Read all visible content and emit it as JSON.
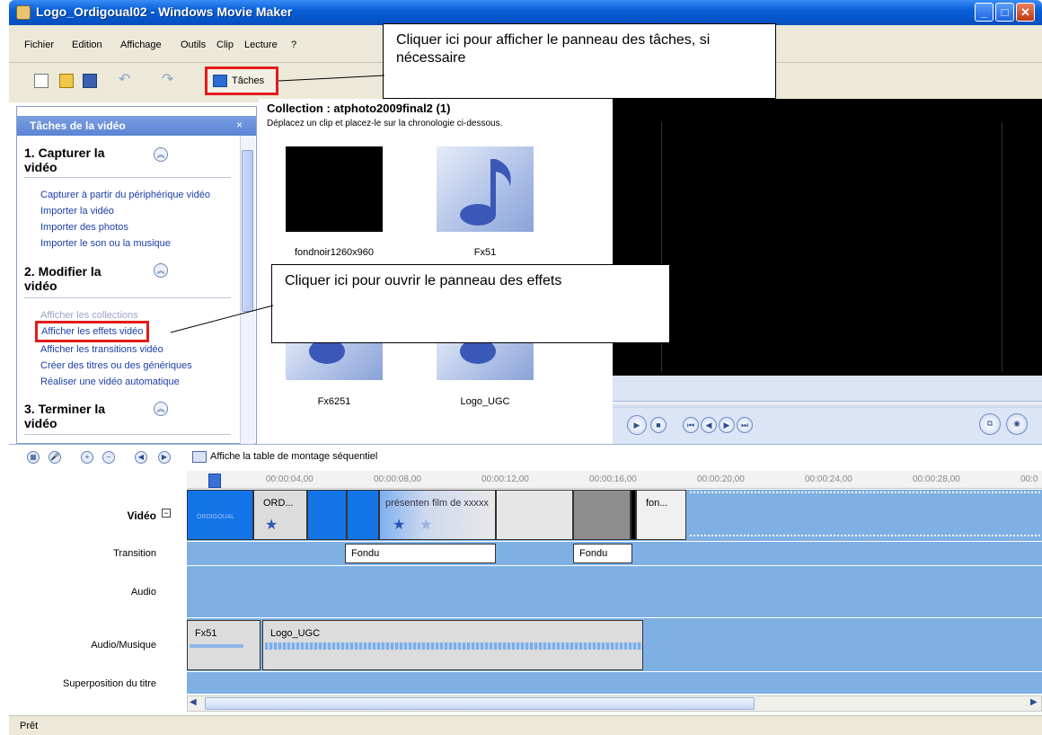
{
  "window": {
    "title": "Logo_Ordigoual02 - Windows Movie Maker"
  },
  "menu": [
    "Fichier",
    "Edition",
    "Affichage",
    "Outils",
    "Clip",
    "Lecture",
    "?"
  ],
  "toolbar": {
    "tasks_label": "Tâches"
  },
  "callouts": {
    "tasks": "Cliquer ici pour afficher le panneau des tâches, si nécessaire",
    "effects": "Cliquer ici pour ouvrir le panneau des effets"
  },
  "taskpane": {
    "title": "Tâches de la vidéo",
    "close": "×",
    "sections": [
      {
        "title": "1. Capturer la vidéo",
        "links": [
          "Capturer à partir du périphérique vidéo",
          "Importer la vidéo",
          "Importer des photos",
          "Importer le son ou la musique"
        ]
      },
      {
        "title": "2. Modifier la vidéo",
        "links": [
          "Afficher les collections",
          "Afficher les effets vidéo",
          "Afficher les transitions vidéo",
          "Créer des titres ou des génériques",
          "Réaliser une vidéo automatique"
        ]
      },
      {
        "title": "3. Terminer la vidéo",
        "links": []
      }
    ]
  },
  "collection": {
    "title": "Collection : atphoto2009final2 (1)",
    "subtitle": "Déplacez un clip et placez-le sur la chronologie ci-dessous.",
    "items": [
      "fondnoir1260x960",
      "Fx51",
      "Fx6251",
      "Logo_UGC"
    ]
  },
  "timeline": {
    "toggle_label": "Affiche la table de montage séquentiel",
    "ruler": [
      "00:00:04,00",
      "00:00:08,00",
      "00:00:12,00",
      "00:00:16,00",
      "00:00:20,00",
      "00:00:24,00",
      "00:00:28,00",
      "00:0"
    ],
    "tracks": {
      "video": "Vidéo",
      "transition": "Transition",
      "audio": "Audio",
      "music": "Audio/Musique",
      "overlay": "Superposition du titre"
    },
    "video_clips": [
      "ORDIGOUAL",
      "ORD...",
      "présenten film de xxxxx",
      "fon..."
    ],
    "transitions": [
      "Fondu",
      "Fondu"
    ],
    "music_clips": [
      "Fx51",
      "Logo_UGC"
    ]
  },
  "status": "Prêt"
}
